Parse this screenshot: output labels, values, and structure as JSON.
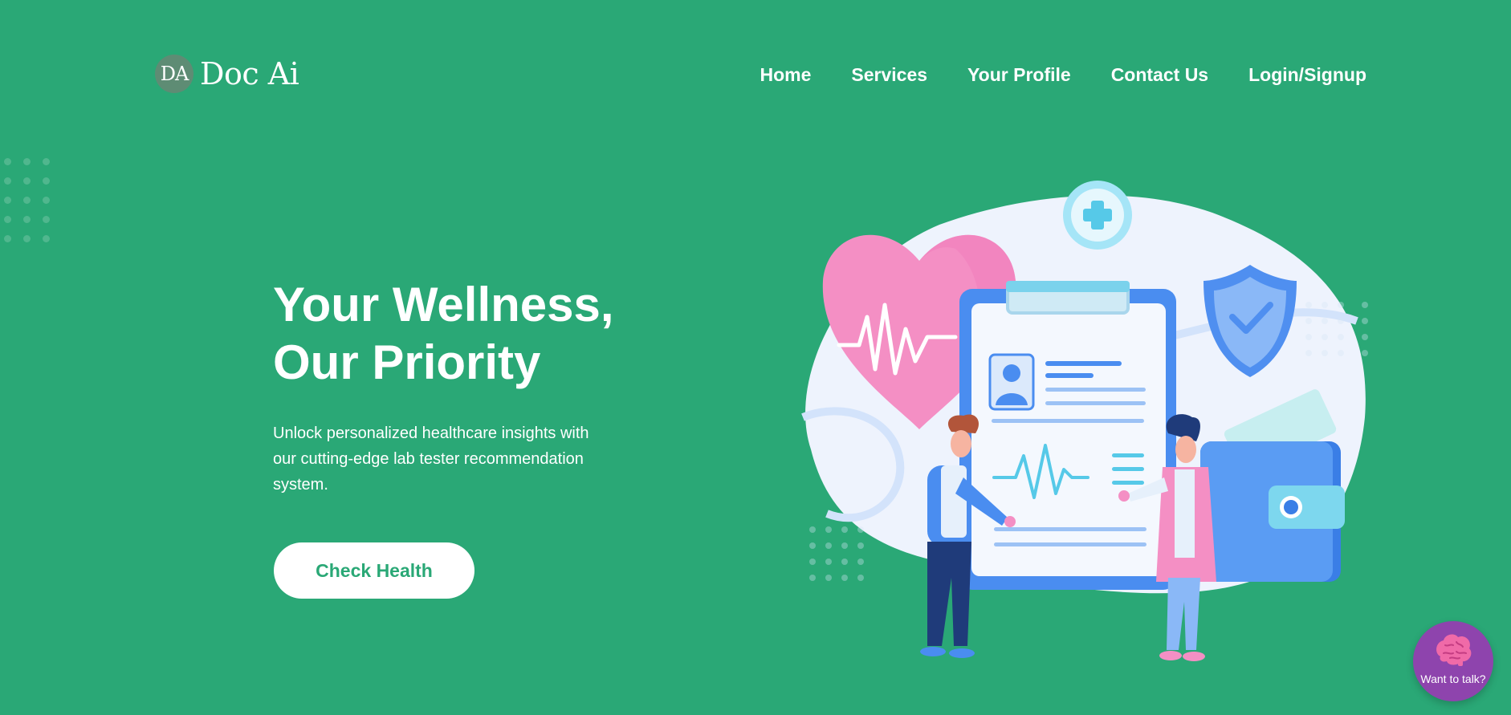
{
  "brand": {
    "badge": "DA",
    "name": "Doc Ai"
  },
  "nav": {
    "home": "Home",
    "services": "Services",
    "profile": "Your Profile",
    "contact": "Contact Us",
    "login": "Login/Signup"
  },
  "hero": {
    "title_line1": "Your Wellness,",
    "title_line2": "Our Priority",
    "description": "Unlock personalized healthcare insights with our cutting-edge lab tester recommendation system.",
    "cta_label": "Check Health"
  },
  "chat": {
    "label": "Want to talk?",
    "icon": "brain-icon"
  },
  "colors": {
    "background": "#2aa876",
    "accent": "#2aa876",
    "chat": "#8e44ad",
    "heart": "#f48fc4",
    "clipboard": "#4a8df0"
  }
}
